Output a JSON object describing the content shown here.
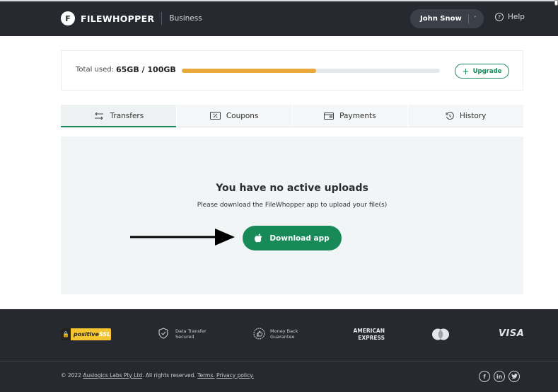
{
  "header": {
    "logo_letter": "F",
    "brand": "FILEWHOPPER",
    "plan": "Business",
    "user": "John Snow",
    "user_chevron": "˅",
    "help": "Help",
    "help_icon": "?"
  },
  "usage": {
    "label": "Total used:",
    "value": "65GB / 100GB",
    "used_fraction": 0.52,
    "upgrade_plus": "+",
    "upgrade_label": "Upgrade"
  },
  "tabs": [
    {
      "label": "Transfers",
      "icon": "transfer-arrows-icon",
      "active": true
    },
    {
      "label": "Coupons",
      "icon": "coupon-icon",
      "active": false
    },
    {
      "label": "Payments",
      "icon": "wallet-icon",
      "active": false
    },
    {
      "label": "History",
      "icon": "history-icon",
      "active": false
    }
  ],
  "empty_state": {
    "title": "You have no active uploads",
    "subtitle": "Please download the FileWhopper app to upload your file(s)",
    "download_label": "Download app"
  },
  "footer": {
    "ssl_text": "positive",
    "ssl_suffix": "SSL",
    "feature_1_line_1": "Data Transfer",
    "feature_1_line_2": "Secured",
    "feature_2_line_1": "Money Back",
    "feature_2_line_2": "Guarantee",
    "amex_line_1": "AMERICAN",
    "amex_line_2": "EXPRESS",
    "visa": "VISA",
    "copyright_prefix": "© 2022 ",
    "company_link": "Auslogics Labs Pty Ltd",
    "rights": ". All rights reserved. ",
    "terms_link": "Terms.",
    "privacy_link": "Privacy policy.",
    "social_facebook": "f",
    "social_linkedin": "in",
    "social_twitter": "t"
  },
  "colors": {
    "header_bg": "#262a30",
    "accent_green": "#178a58",
    "progress_orange": "#e8a93a",
    "panel_bg": "#f1f5f6"
  }
}
